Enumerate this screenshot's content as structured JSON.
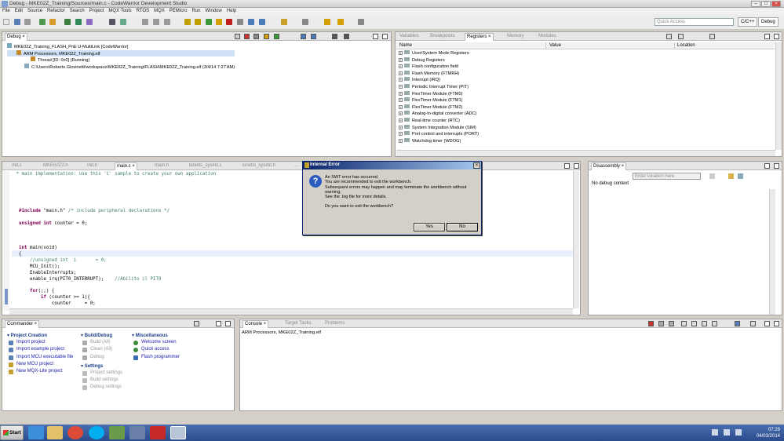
{
  "window": {
    "title": "Debug - MKE02Z_Training/Sources/main.c - CodeWarrior Development Studio"
  },
  "menu": [
    "File",
    "Edit",
    "Source",
    "Refactor",
    "Search",
    "Project",
    "MQX Tools",
    "RTOS",
    "MQX",
    "PEMicro",
    "Run",
    "Window",
    "Help"
  ],
  "quick_access": {
    "placeholder": "Quick Access"
  },
  "perspectives": {
    "cpp": "C/C++",
    "debug": "Debug"
  },
  "debug_view": {
    "tab": "Debug",
    "tree": [
      {
        "label": "MKE02Z_Training_FLASH_PnE U-MultiLink [CodeWarrior]",
        "level": 0
      },
      {
        "label": "ARM Processors, MKE02Z_Training.elf",
        "level": 1
      },
      {
        "label": "Thread [ID: 0x0] (Running)",
        "level": 2
      },
      {
        "label": "C:\\Users\\Roberto.Giovinetti\\workspace\\MKE02Z_Training\\FLASH\\MKE02Z_Training.elf (3/4/14 7:27 AM)",
        "level": 1
      }
    ]
  },
  "registers_view": {
    "tabs": [
      "Variables",
      "Breakpoints",
      "Registers",
      "Memory",
      "Modules"
    ],
    "active_tab": "Registers",
    "columns": [
      "Name",
      "Value",
      "Location"
    ],
    "rows": [
      "User/System Mode Registers",
      "Debug Registers",
      "Flash configuration field",
      "Flash Memory (FTMRH)",
      "Interrupt (IRQ)",
      "Periodic Interrupt Timer (PIT)",
      "FlexTimer Module (FTM0)",
      "FlexTimer Module (FTM1)",
      "FlexTimer Module (FTM2)",
      "Analog-to-digital converter (ADC)",
      "Real-time counter (RTC)",
      "System Integration Module (SIM)",
      "Port control and interrupts (PORT)",
      "Watchdog timer (WDOG)"
    ]
  },
  "editor": {
    "tabs": [
      "Init.c",
      "MKE02Z2.h",
      "Init.h",
      "main.c",
      "main.h",
      "kinetis_sysinit.c",
      "kinetis_sysinit.h",
      "..."
    ],
    "active_tab": "main.c",
    "code": {
      "l1": " * main implementation: use this 'C' sample to create your own application",
      "l_inc_kw": "#include",
      "l_inc_rest": " \"main.h\" ",
      "l_inc_cm": "/* include peripheral declarations */",
      "l_uns_kw": "unsigned int",
      "l_uns_rest": " counter = 0;",
      "l_main_kw": "int",
      "l_main_rest": " main(void)",
      "l_brace": "{",
      "l_cm1": "    //unsigned int  i       = 0;",
      "l_mcu": "    MCU_Init();",
      "l_en": "    EnableInterrupts;",
      "l_irq": "    enable_irq(PIT0_INTERRUPT);",
      "l_irq_cm": "    //Abilito il PIT0",
      "l_for_kw": "    for",
      "l_for_rest": "(;;) {",
      "l_if_kw": "        if",
      "l_if_rest": " (counter >= 1){",
      "l_cnt": "            counter     = 0;"
    }
  },
  "disassembly": {
    "tab": "Disassembly",
    "placeholder": "Enter location here",
    "message": "No debug context"
  },
  "dialog": {
    "title": "Internal Error",
    "lines": [
      "An SWT error has occurred.",
      "You are recommended to exit the workbench.",
      "Subsequent errors may happen and may terminate the workbench without",
      "warning.",
      "See the .log file for more details."
    ],
    "question": "Do you want to exit the workbench?",
    "yes": "Yes",
    "no": "No"
  },
  "commander": {
    "tab": "Commander",
    "project_creation": {
      "title": "Project Creation",
      "items": [
        "Import project",
        "Import example project",
        "Import MCU executable file",
        "New MCU project",
        "New MQX-Lite project"
      ]
    },
    "build_debug": {
      "title": "Build/Debug",
      "items": [
        "Build  (All)",
        "Clean  (All)",
        "Debug"
      ]
    },
    "settings": {
      "title": "Settings",
      "items": [
        "Project settings",
        "Build settings",
        "Debug settings"
      ]
    },
    "misc": {
      "title": "Miscellaneous",
      "items": [
        "Welcome screen",
        "Quick access",
        "Flash programmer"
      ]
    }
  },
  "console": {
    "tabs": [
      "Console",
      "Target Tasks",
      "Problems"
    ],
    "text": "ARM Processors, MKE02Z_Training.elf"
  },
  "taskbar": {
    "start": "Start",
    "time": "07:29",
    "date": "04/03/2014"
  }
}
